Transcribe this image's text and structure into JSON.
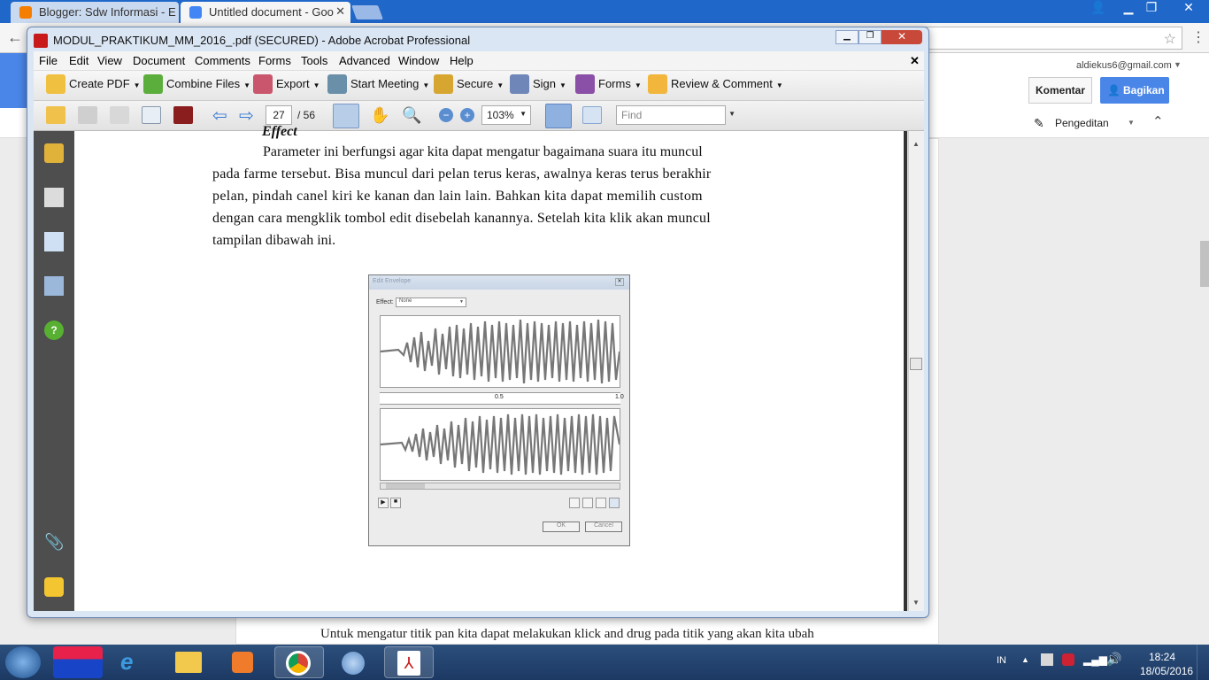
{
  "chrome": {
    "tabs": [
      {
        "title": "Blogger: Sdw Informasi - E",
        "active": false
      },
      {
        "title": "Untitled document - Goo",
        "active": true
      }
    ],
    "close_glyph": "✕"
  },
  "gdocs": {
    "account": "aldiekus6@gmail.com",
    "comment_btn": "Komentar",
    "share_btn": "Bagikan",
    "editing_mode": "Pengeditan",
    "body_line": "Untuk mengatur titik pan kita dapat melakukan klick and drug pada titik yang akan kita ubah"
  },
  "acrobat": {
    "title": "MODUL_PRAKTIKUM_MM_2016_.pdf (SECURED) - Adobe Acrobat Professional",
    "menu": [
      "File",
      "Edit",
      "View",
      "Document",
      "Comments",
      "Forms",
      "Tools",
      "Advanced",
      "Window",
      "Help"
    ],
    "toolbar1": [
      "Create PDF",
      "Combine Files",
      "Export",
      "Start Meeting",
      "Secure",
      "Sign",
      "Forms",
      "Review & Comment"
    ],
    "page_current": "27",
    "page_total": "/ 56",
    "zoom": "103%",
    "find_placeholder": "Find",
    "pdf": {
      "heading_fragment": "Effect",
      "paragraph_lines": [
        "Parameter ini berfungsi agar kita dapat mengatur bagaimana suara itu muncul",
        "pada farme tersebut. Bisa muncul dari pelan terus keras, awalnya keras terus berakhir",
        "pelan, pindah canel kiri ke kanan dan lain lain. Bahkan kita dapat memilih custom",
        "dengan cara mengklik tombol edit disebelah kanannya. Setelah kita klik akan muncul",
        "tampilan dibawah ini."
      ],
      "figure": {
        "title": "Edit Envelope",
        "effect_label": "Effect:",
        "effect_value": "None",
        "mid_label": "0.5",
        "end_label": "1.0",
        "ok": "OK",
        "cancel": "Cancel"
      }
    }
  },
  "taskbar": {
    "lang": "IN",
    "time": "18:24",
    "date": "18/05/2016"
  }
}
